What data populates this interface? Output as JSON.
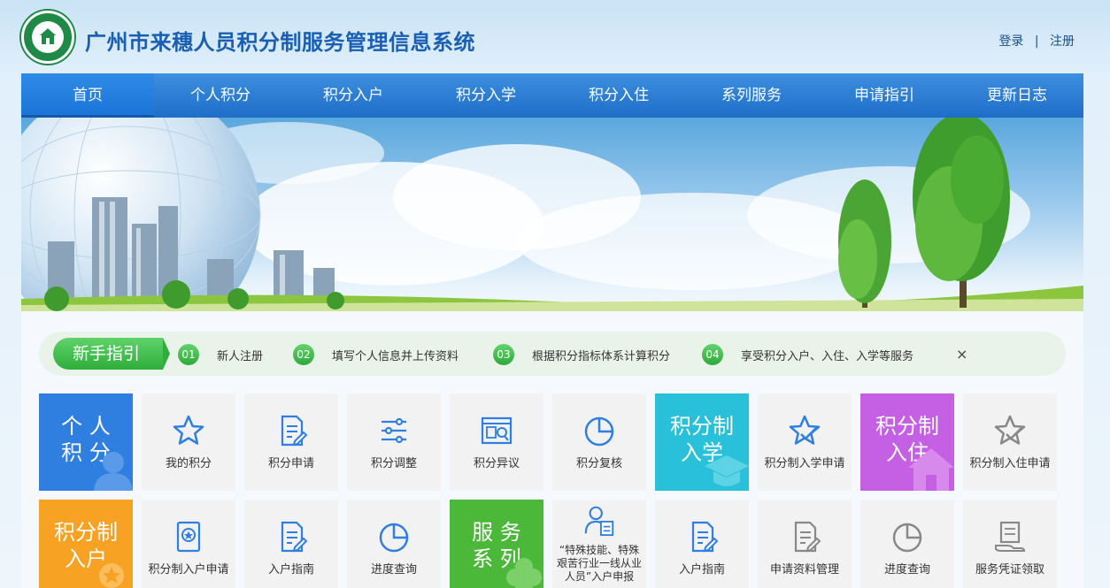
{
  "header": {
    "title": "广州市来穗人员积分制服务管理信息系统",
    "login": "登录",
    "separator": "|",
    "register": "注册"
  },
  "nav": [
    {
      "label": "首页",
      "active": true
    },
    {
      "label": "个人积分"
    },
    {
      "label": "积分入户"
    },
    {
      "label": "积分入学"
    },
    {
      "label": "积分入住"
    },
    {
      "label": "系列服务"
    },
    {
      "label": "申请指引"
    },
    {
      "label": "更新日志"
    }
  ],
  "guide": {
    "tag": "新手指引",
    "steps": [
      {
        "num": "01",
        "text": "新人注册"
      },
      {
        "num": "02",
        "text": "填写个人信息并上传资料"
      },
      {
        "num": "03",
        "text": "根据积分指标体系计算积分"
      },
      {
        "num": "04",
        "text": "享受积分入户、入住、入学等服务"
      }
    ],
    "close": "×"
  },
  "categories": {
    "personal": {
      "line1": "个 人",
      "line2": "积 分",
      "color": "#2f7fe0"
    },
    "school": {
      "line1": "积分制",
      "line2": "入学",
      "color": "#29c1d9"
    },
    "housing": {
      "line1": "积分制",
      "line2": "入住",
      "color": "#c55fe3"
    },
    "household": {
      "line1": "积分制",
      "line2": "入户",
      "color": "#f8a223"
    },
    "service": {
      "line1": "服 务",
      "line2": "系 列",
      "color": "#4cb83a"
    }
  },
  "tiles_row1": [
    {
      "label": "我的积分",
      "icon": "star-icon"
    },
    {
      "label": "积分申请",
      "icon": "form-edit-icon"
    },
    {
      "label": "积分调整",
      "icon": "sliders-icon"
    },
    {
      "label": "积分异议",
      "icon": "document-search-icon"
    },
    {
      "label": "积分复核",
      "icon": "pie-chart-icon"
    },
    {
      "label": "积分制入学申请",
      "icon": "star-check-icon"
    },
    {
      "label": "积分制入住申请",
      "icon": "star-check-icon"
    }
  ],
  "tiles_row2": [
    {
      "label": "积分制入户申请",
      "icon": "badge-star-icon"
    },
    {
      "label": "入户指南",
      "icon": "form-edit-icon"
    },
    {
      "label": "进度查询",
      "icon": "pie-chart-icon"
    },
    {
      "label": "“特殊技能、特殊艰苦行业一线从业人员”入户申报",
      "icon": "user-document-icon"
    },
    {
      "label": "入户指南",
      "icon": "form-edit-icon"
    },
    {
      "label": "申请资料管理",
      "icon": "form-edit-icon"
    },
    {
      "label": "进度查询",
      "icon": "pie-chart-icon"
    },
    {
      "label": "服务凭证领取",
      "icon": "hand-document-icon"
    }
  ]
}
